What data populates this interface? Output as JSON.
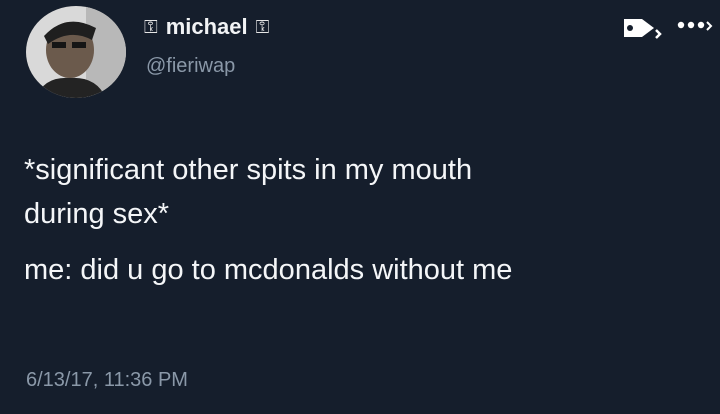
{
  "author": {
    "display_name": "michael",
    "handle": "@fieriwap",
    "name_prefix_icon": "key-icon",
    "name_suffix_icon": "key-icon"
  },
  "header_actions": {
    "tag_icon": "tag-icon",
    "more_icon": "more-dots-icon"
  },
  "tweet": {
    "lines": [
      "*significant other spits in my mouth",
      "during sex*",
      "me: did u go to mcdonalds without me"
    ],
    "timestamp": "6/13/17, 11:36 PM"
  },
  "colors": {
    "background": "#151e2c",
    "primary_text": "#f4f6f8",
    "secondary_text": "#8a98a8"
  }
}
